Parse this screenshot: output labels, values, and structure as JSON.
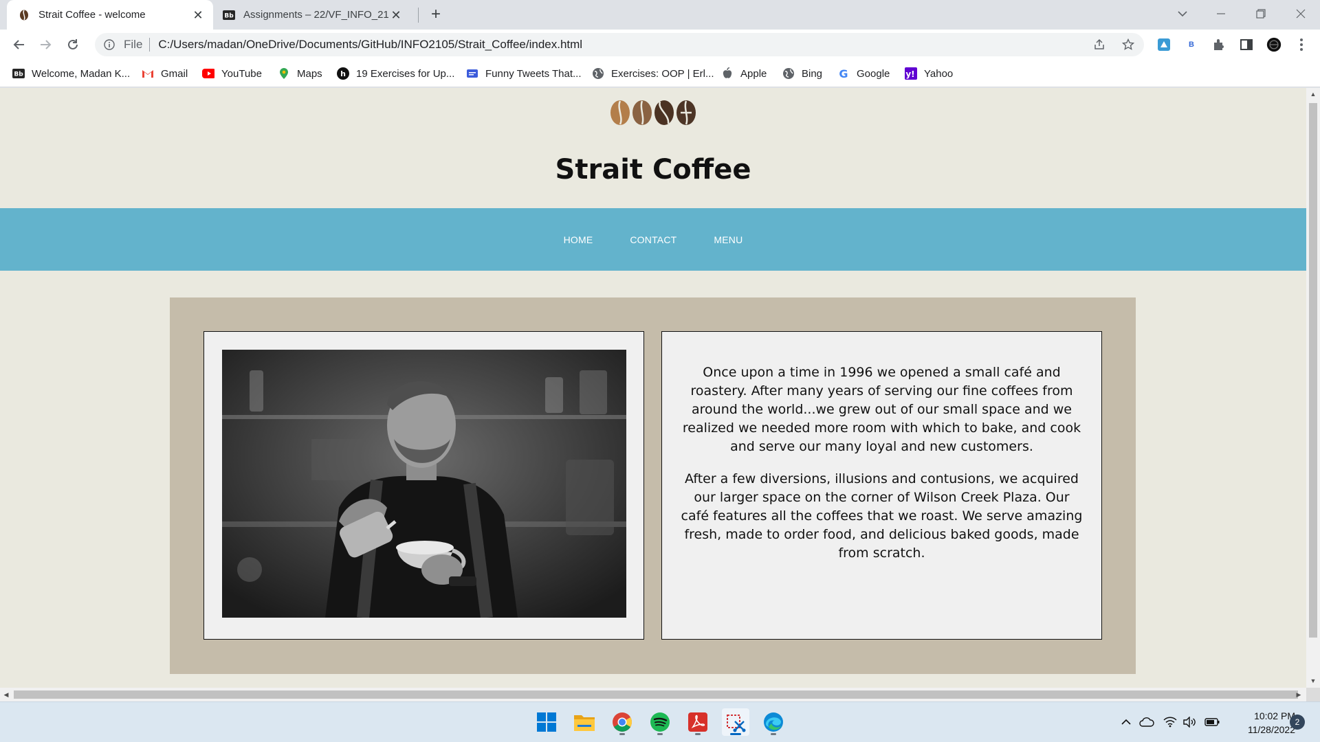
{
  "browser": {
    "tabs": [
      {
        "title": "Strait Coffee - welcome",
        "active": true
      },
      {
        "title": "Assignments – 22/VF_INFO_2105",
        "active": false
      }
    ],
    "address": {
      "scheme_label": "File",
      "url": "C:/Users/madan/OneDrive/Documents/GitHub/INFO2105/Strait_Coffee/index.html"
    },
    "extensions": {
      "b_label": "B"
    },
    "bookmarks": [
      {
        "label": "Welcome, Madan K...",
        "icon": "blackboard-icon"
      },
      {
        "label": "Gmail",
        "icon": "gmail-icon"
      },
      {
        "label": "YouTube",
        "icon": "youtube-icon"
      },
      {
        "label": "Maps",
        "icon": "maps-icon"
      },
      {
        "label": "19 Exercises for Up...",
        "icon": "site-icon"
      },
      {
        "label": "Funny Tweets That...",
        "icon": "site-icon"
      },
      {
        "label": "Exercises: OOP | Erl...",
        "icon": "globe-icon"
      },
      {
        "label": "Apple",
        "icon": "apple-icon"
      },
      {
        "label": "Bing",
        "icon": "globe-icon"
      },
      {
        "label": "Google",
        "icon": "google-icon"
      },
      {
        "label": "Yahoo",
        "icon": "yahoo-icon"
      }
    ]
  },
  "site": {
    "title": "Strait Coffee",
    "nav": [
      "HOME",
      "CONTACT",
      "MENU"
    ],
    "nav_color": "#63b3cc",
    "paragraphs": [
      "Once upon a time in 1996 we opened a small café and roastery. After many years of serving our fine coffees from around the world...we grew out of our small space and we realized we needed more room with which to bake, and cook and serve our many loyal and new customers.",
      "After a few diversions, illusions and contusions, we acquired our larger space on the corner of Wilson Creek Plaza. Our café features all the coffees that we roast. We serve amazing fresh, made to order food, and delicious baked goods, made from scratch."
    ]
  },
  "taskbar": {
    "time": "10:02 PM",
    "date": "11/28/2022",
    "notifications": "2",
    "accent": "#0067c0"
  }
}
